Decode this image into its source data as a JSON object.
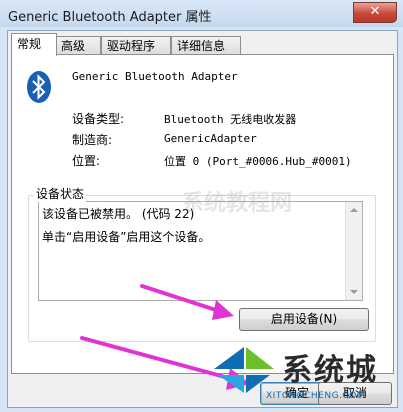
{
  "window": {
    "title": "Generic Bluetooth Adapter 属性",
    "close_glyph": "✕"
  },
  "tabs": [
    {
      "label": "常规",
      "active": true
    },
    {
      "label": "高级",
      "active": false
    },
    {
      "label": "驱动程序",
      "active": false
    },
    {
      "label": "详细信息",
      "active": false
    }
  ],
  "device": {
    "icon": "bluetooth-icon",
    "name": "Generic Bluetooth Adapter",
    "props": [
      {
        "label": "设备类型:",
        "value": "Bluetooth 无线电收发器"
      },
      {
        "label": "制造商:",
        "value": "GenericAdapter"
      },
      {
        "label": "位置:",
        "value": "位置 0 (Port_#0006.Hub_#0001)"
      }
    ]
  },
  "status": {
    "group_title": "设备状态",
    "lines": [
      "该设备已被禁用。 (代码 22)",
      "单击“启用设备”启用这个设备。"
    ],
    "enable_button": "启用设备(N)"
  },
  "footer": {
    "ok": "确定",
    "cancel": "取消"
  },
  "watermark": {
    "text": "系统教程网"
  },
  "logo": {
    "name": "系统城",
    "url": "XITONGCHENG.COM"
  },
  "colors": {
    "accent": "#1a5fb4",
    "arrow": "#e033d4",
    "logo_blue": "#0f6db5",
    "logo_green": "#6cbf2a"
  }
}
